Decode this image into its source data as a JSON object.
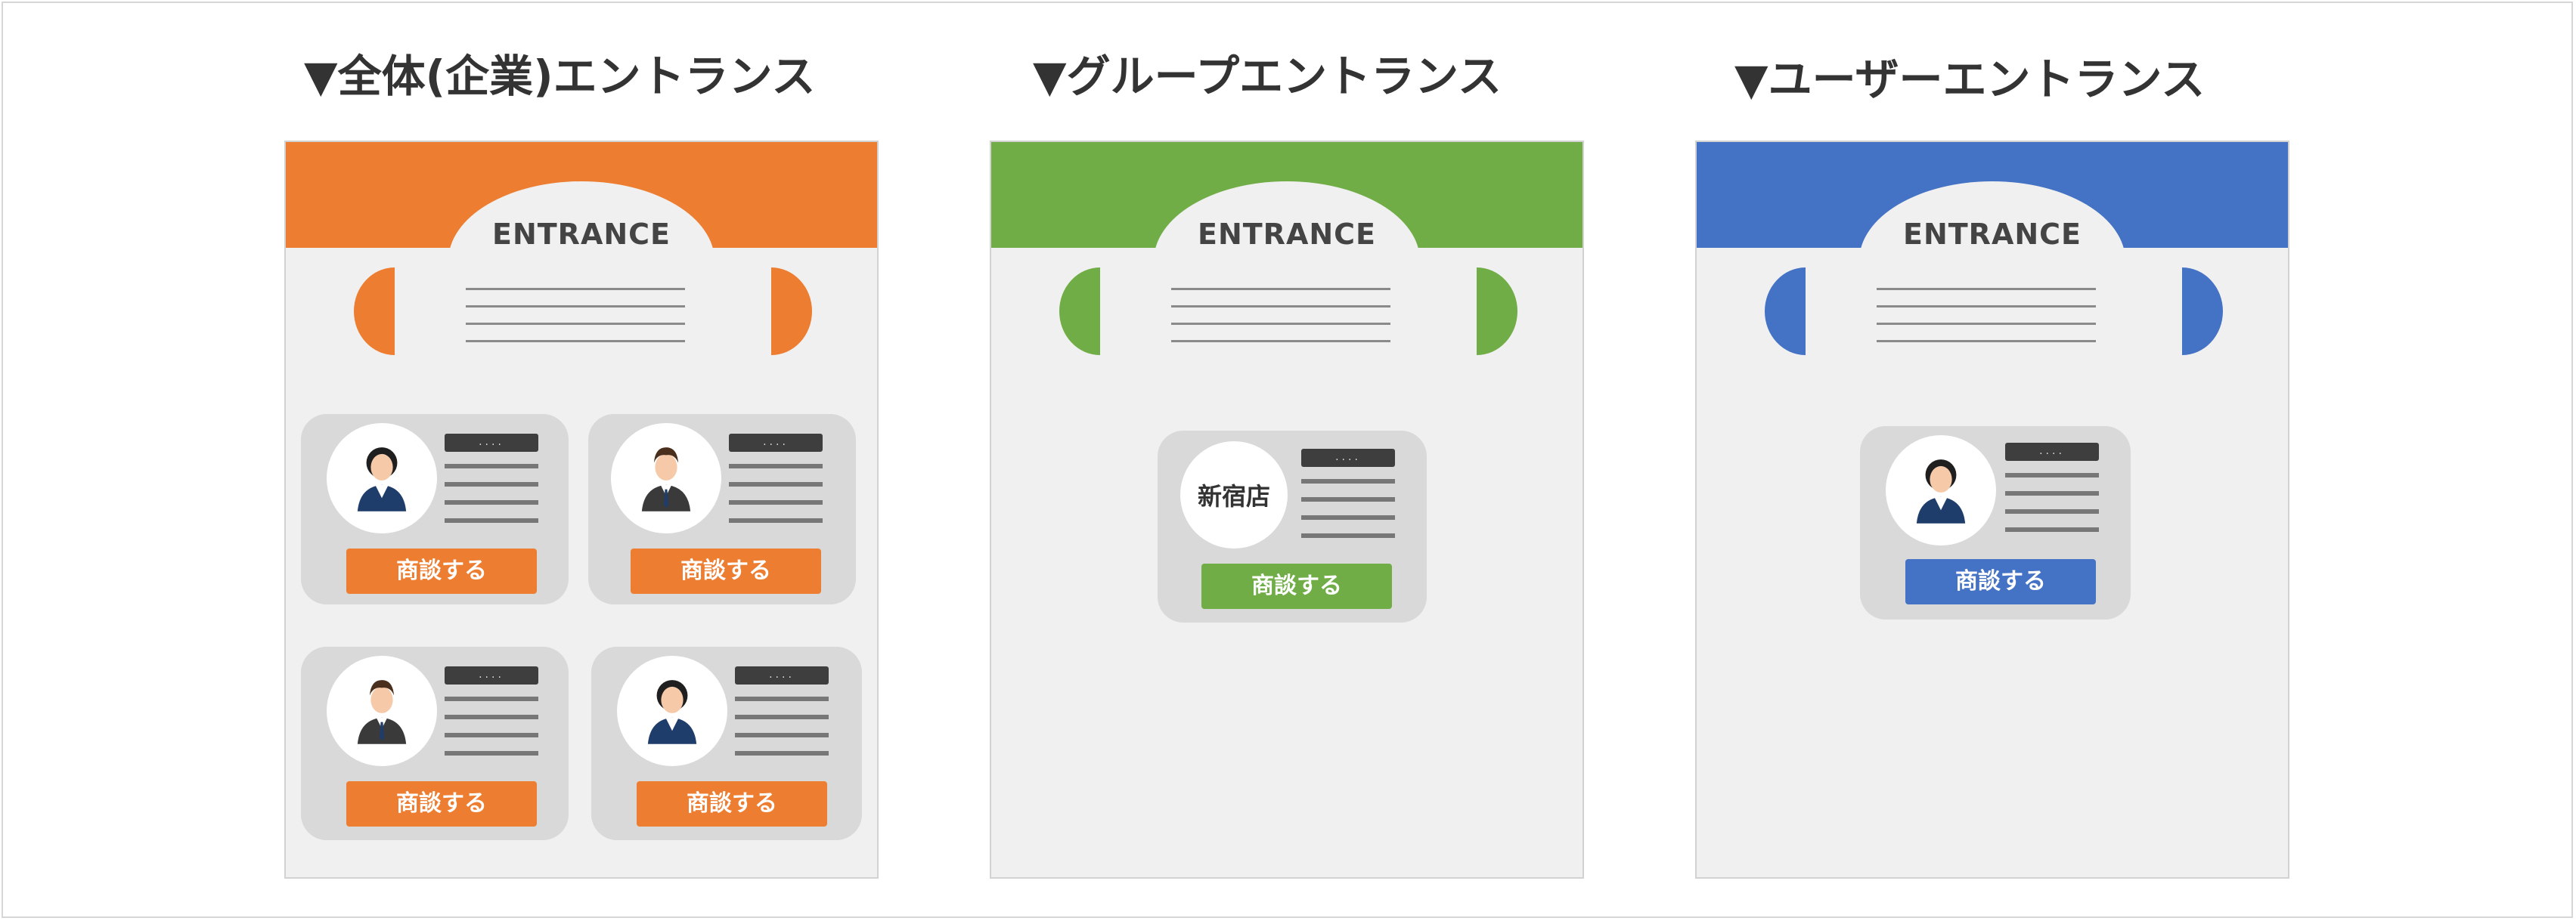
{
  "titles": {
    "company": "▼全体(企業)エントランス",
    "group": "▼グループエントランス",
    "user": "▼ユーザーエントランス"
  },
  "entrance_label": "ENTRANCE",
  "button_label": "商談する",
  "tag_label": "....",
  "store_name": "新宿店",
  "colors": {
    "company": "#ed7d31",
    "group": "#70ad47",
    "user": "#4472c4",
    "panel_bg": "#f0f0f0",
    "card_bg": "#d9d9d9"
  },
  "icons": {
    "woman": "businesswoman-avatar-icon",
    "man": "businessman-avatar-icon"
  }
}
